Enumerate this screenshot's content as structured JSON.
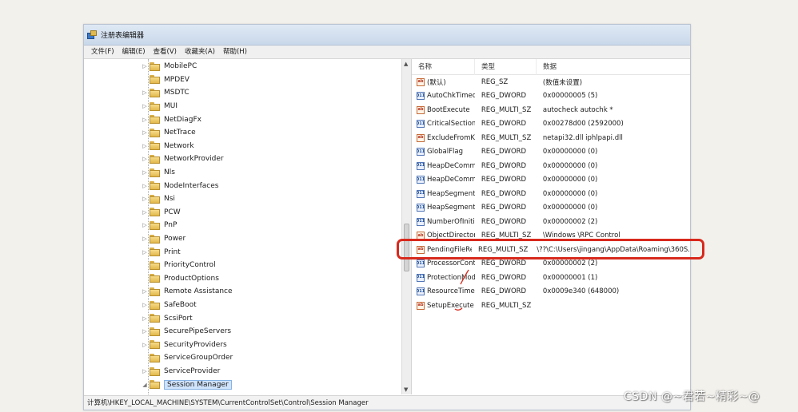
{
  "window": {
    "title": "注册表编辑器"
  },
  "menu": [
    "文件(F)",
    "编辑(E)",
    "查看(V)",
    "收藏夹(A)",
    "帮助(H)"
  ],
  "tree": {
    "items": [
      {
        "label": "MobilePC",
        "expandable": true
      },
      {
        "label": "MPDEV",
        "expandable": false
      },
      {
        "label": "MSDTC",
        "expandable": true
      },
      {
        "label": "MUI",
        "expandable": true
      },
      {
        "label": "NetDiagFx",
        "expandable": true
      },
      {
        "label": "NetTrace",
        "expandable": true
      },
      {
        "label": "Network",
        "expandable": true
      },
      {
        "label": "NetworkProvider",
        "expandable": true
      },
      {
        "label": "Nls",
        "expandable": true
      },
      {
        "label": "NodeInterfaces",
        "expandable": true
      },
      {
        "label": "Nsi",
        "expandable": true
      },
      {
        "label": "PCW",
        "expandable": true
      },
      {
        "label": "PnP",
        "expandable": true
      },
      {
        "label": "Power",
        "expandable": true
      },
      {
        "label": "Print",
        "expandable": true
      },
      {
        "label": "PriorityControl",
        "expandable": false
      },
      {
        "label": "ProductOptions",
        "expandable": false
      },
      {
        "label": "Remote Assistance",
        "expandable": true
      },
      {
        "label": "SafeBoot",
        "expandable": true
      },
      {
        "label": "ScsiPort",
        "expandable": true
      },
      {
        "label": "SecurePipeServers",
        "expandable": true
      },
      {
        "label": "SecurityProviders",
        "expandable": true
      },
      {
        "label": "ServiceGroupOrder",
        "expandable": false
      },
      {
        "label": "ServiceProvider",
        "expandable": true
      },
      {
        "label": "Session Manager",
        "expandable": true,
        "expanded": true,
        "selected": true
      }
    ]
  },
  "list": {
    "headers": {
      "name": "名称",
      "type": "类型",
      "data": "数据"
    },
    "rows": [
      {
        "name": "(默认)",
        "type": "REG_SZ",
        "data": "(数值未设置)",
        "icon": "string-value-icon"
      },
      {
        "name": "AutoChkTimeout",
        "type": "REG_DWORD",
        "data": "0x00000005 (5)",
        "icon": "binary-value-icon"
      },
      {
        "name": "BootExecute",
        "type": "REG_MULTI_SZ",
        "data": "autocheck autochk *",
        "icon": "string-value-icon"
      },
      {
        "name": "CriticalSection...",
        "type": "REG_DWORD",
        "data": "0x00278d00 (2592000)",
        "icon": "binary-value-icon"
      },
      {
        "name": "ExcludeFromK...",
        "type": "REG_MULTI_SZ",
        "data": "netapi32.dll iphlpapi.dll",
        "icon": "string-value-icon"
      },
      {
        "name": "GlobalFlag",
        "type": "REG_DWORD",
        "data": "0x00000000 (0)",
        "icon": "binary-value-icon"
      },
      {
        "name": "HeapDeComm...",
        "type": "REG_DWORD",
        "data": "0x00000000 (0)",
        "icon": "binary-value-icon"
      },
      {
        "name": "HeapDeComm...",
        "type": "REG_DWORD",
        "data": "0x00000000 (0)",
        "icon": "binary-value-icon"
      },
      {
        "name": "HeapSegment...",
        "type": "REG_DWORD",
        "data": "0x00000000 (0)",
        "icon": "binary-value-icon"
      },
      {
        "name": "HeapSegment...",
        "type": "REG_DWORD",
        "data": "0x00000000 (0)",
        "icon": "binary-value-icon"
      },
      {
        "name": "NumberOfIniti...",
        "type": "REG_DWORD",
        "data": "0x00000002 (2)",
        "icon": "binary-value-icon"
      },
      {
        "name": "ObjectDirector...",
        "type": "REG_MULTI_SZ",
        "data": "\\Windows \\RPC Control",
        "icon": "string-value-icon"
      },
      {
        "name": "PendingFileRe...",
        "type": "REG_MULTI_SZ",
        "data": "\\??\\C:\\Users\\jingang\\AppData\\Roaming\\360S.",
        "icon": "string-value-icon"
      },
      {
        "name": "ProcessorCont...",
        "type": "REG_DWORD",
        "data": "0x00000002 (2)",
        "icon": "binary-value-icon"
      },
      {
        "name": "ProtectionMode",
        "type": "REG_DWORD",
        "data": "0x00000001 (1)",
        "icon": "binary-value-icon"
      },
      {
        "name": "ResourceTime...",
        "type": "REG_DWORD",
        "data": "0x0009e340 (648000)",
        "icon": "binary-value-icon"
      },
      {
        "name": "SetupExecute",
        "type": "REG_MULTI_SZ",
        "data": "",
        "icon": "string-value-icon"
      }
    ]
  },
  "status_bar": "计算机\\HKEY_LOCAL_MACHINE\\SYSTEM\\CurrentControlSet\\Control\\Session Manager",
  "watermark": "CSDN @~君若~精彩~@",
  "colors": {
    "annotation": "#d8291d",
    "selection": "#cfe3fb"
  }
}
